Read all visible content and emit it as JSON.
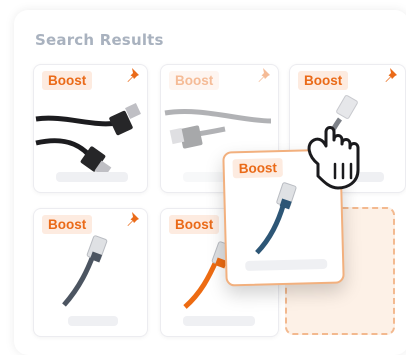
{
  "panel": {
    "title": "Search Results"
  },
  "cards": [
    {
      "badge": "Boost",
      "product": "black-hdmi-cable",
      "pinned": true
    },
    {
      "badge": "Boost",
      "product": "gray-hdmi-cable",
      "pinned": true,
      "state": "faded"
    },
    {
      "badge": "Boost",
      "product": "ethernet-cable",
      "pinned": true
    },
    {
      "badge": "Boost",
      "product": "gray-ethernet-cable",
      "pinned": true
    },
    {
      "badge": "Boost",
      "product": "orange-ethernet-cable",
      "pinned": true
    }
  ],
  "drag_card": {
    "badge": "Boost",
    "product": "blue-ethernet-cable"
  },
  "colors": {
    "accent": "#ea6a18",
    "badge_bg": "#fdebe0",
    "drop_slot": "#fdf1e7"
  },
  "icons": {
    "pin": "pushpin-icon",
    "hand": "hand-grab-icon"
  }
}
